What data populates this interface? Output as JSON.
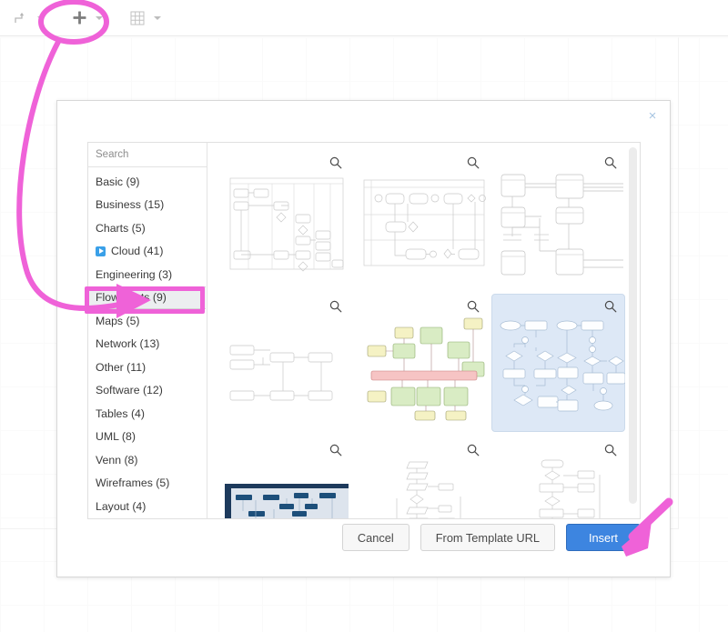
{
  "toolbar": {
    "items": [
      {
        "name": "waypoints-icon",
        "label": "Waypoints"
      },
      {
        "name": "insert-plus-icon",
        "label": "Insert"
      },
      {
        "name": "table-grid-icon",
        "label": "Table"
      }
    ]
  },
  "dialog": {
    "close_label": "×",
    "search": {
      "placeholder": "Search",
      "value": ""
    },
    "categories": [
      {
        "label": "Basic (9)",
        "selected": false,
        "icon": null
      },
      {
        "label": "Business (15)",
        "selected": false,
        "icon": null
      },
      {
        "label": "Charts (5)",
        "selected": false,
        "icon": null
      },
      {
        "label": "Cloud (41)",
        "selected": false,
        "icon": "expand-play-icon"
      },
      {
        "label": "Engineering (3)",
        "selected": false,
        "icon": null
      },
      {
        "label": "Flowcharts (9)",
        "selected": true,
        "icon": null
      },
      {
        "label": "Maps (5)",
        "selected": false,
        "icon": null
      },
      {
        "label": "Network (13)",
        "selected": false,
        "icon": null
      },
      {
        "label": "Other (11)",
        "selected": false,
        "icon": null
      },
      {
        "label": "Software (12)",
        "selected": false,
        "icon": null
      },
      {
        "label": "Tables (4)",
        "selected": false,
        "icon": null
      },
      {
        "label": "UML (8)",
        "selected": false,
        "icon": null
      },
      {
        "label": "Venn (8)",
        "selected": false,
        "icon": null
      },
      {
        "label": "Wireframes (5)",
        "selected": false,
        "icon": null
      },
      {
        "label": "Layout (4)",
        "selected": false,
        "icon": null
      }
    ],
    "templates": [
      {
        "style": "swimlane-gray",
        "selected": false
      },
      {
        "style": "bpmn-gray",
        "selected": false
      },
      {
        "style": "er-gray",
        "selected": false
      },
      {
        "style": "tree-gray",
        "selected": false
      },
      {
        "style": "colored-green-yellow",
        "selected": false
      },
      {
        "style": "blue-flow",
        "selected": true
      },
      {
        "style": "dark-navy",
        "selected": false
      },
      {
        "style": "vertical-flow-a",
        "selected": false
      },
      {
        "style": "vertical-flow-b",
        "selected": false
      }
    ],
    "buttons": {
      "cancel": "Cancel",
      "from_template_url": "From Template URL",
      "insert": "Insert"
    }
  },
  "annotation": {
    "color": "#ef62d8",
    "ellipse_target": "insert-plus-icon",
    "arrow_target": "Flowcharts (9)",
    "arrow2_target": "Insert"
  }
}
